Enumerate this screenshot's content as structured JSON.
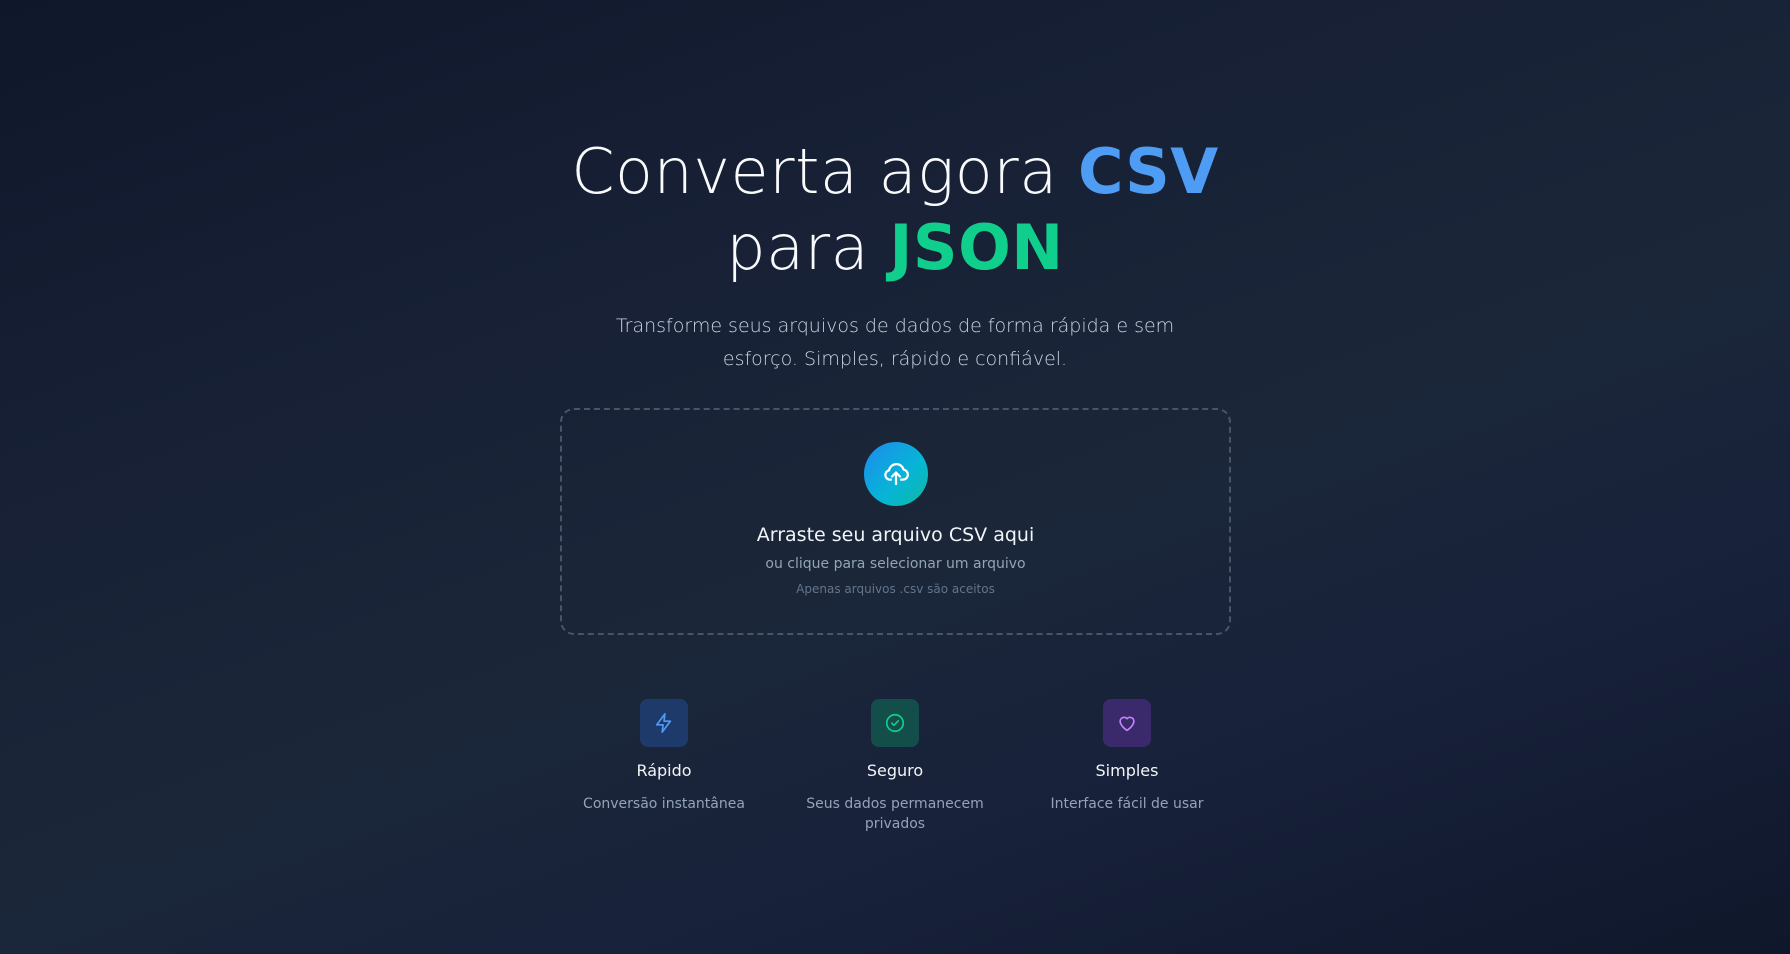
{
  "hero": {
    "title_part1": "Converta agora",
    "title_csv": "CSV",
    "title_part2": "para",
    "title_json": "JSON",
    "subtitle": "Transforme seus arquivos de dados de forma rápida e sem esforço. Simples, rápido e confiável."
  },
  "dropzone": {
    "icon": "cloud-upload-icon",
    "title": "Arraste seu arquivo CSV aqui",
    "subtitle": "ou clique para selecionar um arquivo",
    "note": "Apenas arquivos .csv são aceitos"
  },
  "features": [
    {
      "icon": "lightning-icon",
      "title": "Rápido",
      "description": "Conversão instantânea",
      "color": "#4f9cf5",
      "bg": "#1e3a6b"
    },
    {
      "icon": "check-circle-icon",
      "title": "Seguro",
      "description": "Seus dados permanecem privados",
      "color": "#10cf8c",
      "bg": "#134e4a"
    },
    {
      "icon": "heart-icon",
      "title": "Simples",
      "description": "Interface fácil de usar",
      "color": "#c084fc",
      "bg": "#3b2a6b"
    }
  ],
  "colors": {
    "accent_csv": "#4f9cf5",
    "accent_json": "#10cf8c",
    "background": "#172035"
  }
}
